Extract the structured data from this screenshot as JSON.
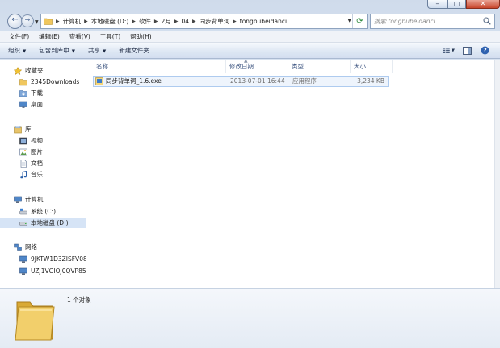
{
  "window": {
    "controls": {
      "minimize": "–",
      "maximize": "□",
      "close": "✕"
    }
  },
  "nav": {
    "back_glyph": "←",
    "forward_glyph": "→"
  },
  "address": {
    "crumbs": [
      "计算机",
      "本地磁盘 (D:)",
      "软件",
      "2月",
      "04",
      "同步背单词",
      "tongbubeidanci"
    ],
    "refresh_glyph": "⟳"
  },
  "search": {
    "placeholder": "搜索 tongbubeidanci"
  },
  "menu": [
    "文件(F)",
    "编辑(E)",
    "查看(V)",
    "工具(T)",
    "帮助(H)"
  ],
  "toolbar": {
    "organize": "组织",
    "include_in_library": "包含到库中",
    "share": "共享",
    "new_folder": "新建文件夹",
    "help_glyph": "?"
  },
  "sidebar": {
    "favorites": {
      "label": "收藏夹",
      "items": [
        "2345Downloads",
        "下载",
        "桌面"
      ]
    },
    "libraries": {
      "label": "库",
      "items": [
        "视频",
        "图片",
        "文档",
        "音乐"
      ]
    },
    "computer": {
      "label": "计算机",
      "items": [
        "系统 (C:)",
        "本地磁盘 (D:)"
      ]
    },
    "network": {
      "label": "网络",
      "items": [
        "9JKTW1D3ZISFV08",
        "UZJ1VGIOJ0QVP85"
      ]
    }
  },
  "columns": {
    "name": "名称",
    "date": "修改日期",
    "type": "类型",
    "size": "大小"
  },
  "files": [
    {
      "name": "同步背单词_1.6.exe",
      "date": "2013-07-01 16:44",
      "type": "应用程序",
      "size": "3,234 KB"
    }
  ],
  "status": {
    "count": "1 个对象"
  },
  "colors": {
    "accent": "#3b6fb6",
    "selection": "#d6e4f6",
    "title_blue": "#cfdbeb"
  }
}
